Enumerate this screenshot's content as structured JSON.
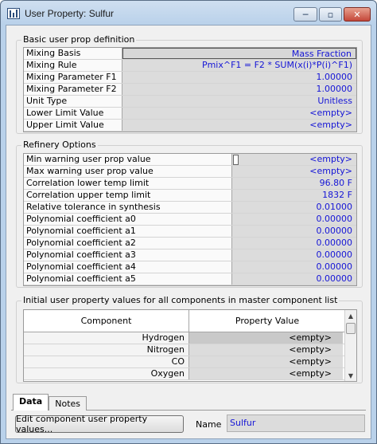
{
  "window": {
    "title": "User Property: Sulfur",
    "minimize_glyph": "─",
    "restore_glyph": "▫",
    "close_glyph": "✕"
  },
  "basic": {
    "legend": "Basic user prop definition",
    "rows": [
      {
        "label": "Mixing Basis",
        "value": "Mass Fraction"
      },
      {
        "label": "Mixing Rule",
        "value": "Pmix^F1 = F2 * SUM(x(i)*P(i)^F1)"
      },
      {
        "label": "Mixing Parameter F1",
        "value": "1.00000"
      },
      {
        "label": "Mixing Parameter F2",
        "value": "1.00000"
      },
      {
        "label": "Unit Type",
        "value": "Unitless"
      },
      {
        "label": "Lower Limit Value",
        "value": "<empty>"
      },
      {
        "label": "Upper Limit Value",
        "value": "<empty>"
      }
    ]
  },
  "refinery": {
    "legend": "Refinery Options",
    "rows": [
      {
        "label": "Min warning user prop value",
        "value": "<empty>"
      },
      {
        "label": "Max warning user prop value",
        "value": "<empty>"
      },
      {
        "label": "Correlation lower temp limit",
        "value": "96.80 F"
      },
      {
        "label": "Correlation upper temp limit",
        "value": "1832 F"
      },
      {
        "label": "Relative tolerance in synthesis",
        "value": "0.01000"
      },
      {
        "label": "Polynomial coefficient a0",
        "value": "0.00000"
      },
      {
        "label": "Polynomial coefficient a1",
        "value": "0.00000"
      },
      {
        "label": "Polynomial coefficient a2",
        "value": "0.00000"
      },
      {
        "label": "Polynomial coefficient a3",
        "value": "0.00000"
      },
      {
        "label": "Polynomial coefficient a4",
        "value": "0.00000"
      },
      {
        "label": "Polynomial coefficient a5",
        "value": "0.00000"
      }
    ]
  },
  "initial": {
    "legend": "Initial user property values for all components in master component list",
    "columns": [
      "Component",
      "Property Value"
    ],
    "rows": [
      {
        "component": "Hydrogen",
        "value": "<empty>"
      },
      {
        "component": "Nitrogen",
        "value": "<empty>"
      },
      {
        "component": "CO",
        "value": "<empty>"
      },
      {
        "component": "Oxygen",
        "value": "<empty>"
      }
    ]
  },
  "tabs": [
    {
      "label": "Data",
      "active": true
    },
    {
      "label": "Notes",
      "active": false
    }
  ],
  "footer": {
    "edit_button": "Edit component user property values...",
    "name_label": "Name",
    "name_value": "Sulfur"
  }
}
